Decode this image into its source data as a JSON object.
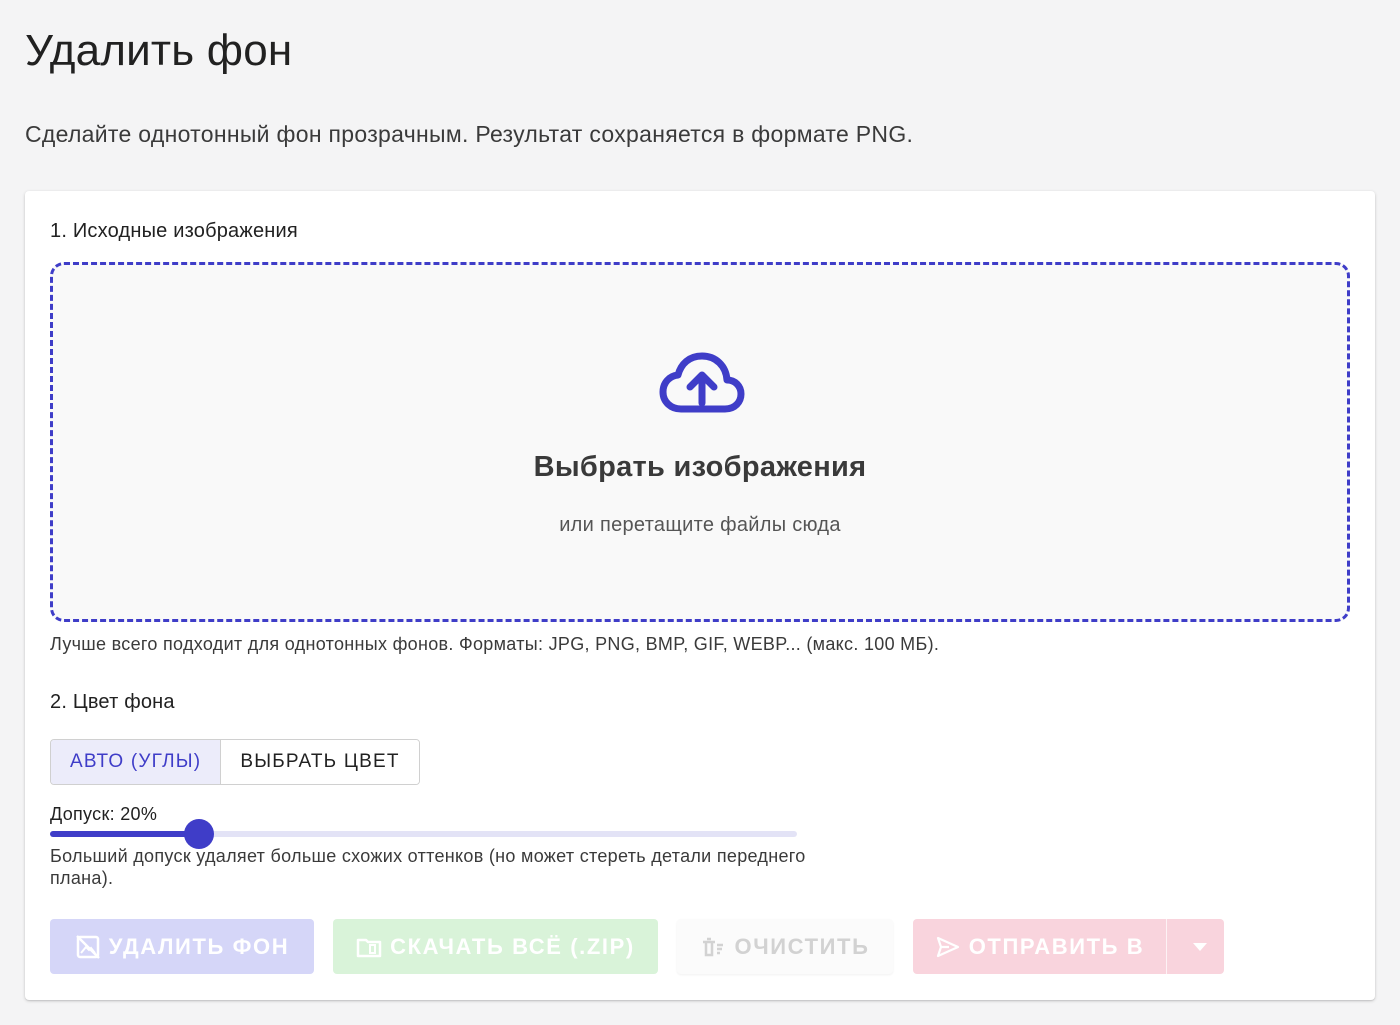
{
  "page": {
    "title": "Удалить фон",
    "subtitle": "Сделайте однотонный фон прозрачным. Результат сохраняется в формате PNG."
  },
  "source_section": {
    "title": "1. Исходные изображения",
    "dropzone": {
      "icon": "cloud-upload-icon",
      "title": "Выбрать изображения",
      "hint": "или перетащите файлы сюда"
    },
    "formats_hint": "Лучше всего подходит для однотонных фонов. Форматы: JPG, PNG, BMP, GIF, WEBP... (макс. 100 МБ)."
  },
  "color_section": {
    "title": "2. Цвет фона",
    "modes": [
      {
        "label": "АВТО (УГЛЫ)",
        "active": true
      },
      {
        "label": "ВЫБРАТЬ ЦВЕТ",
        "active": false
      }
    ],
    "tolerance_label": "Допуск: 20%",
    "tolerance_value": 0.2,
    "tolerance_hint": "Больший допуск удаляет больше схожих оттенков (но может стереть детали переднего плана)."
  },
  "actions": {
    "remove_label": "УДАЛИТЬ ФОН",
    "download_label": "СКАЧАТЬ ВСЁ (.ZIP)",
    "clear_label": "ОЧИСТИТЬ",
    "send_label": "ОТПРАВИТЬ В"
  },
  "colors": {
    "accent": "#3f3dc8",
    "remove_disabled": "#d5d6f8",
    "download_disabled": "#d9f3d9",
    "send_disabled": "#f9d4dd"
  }
}
